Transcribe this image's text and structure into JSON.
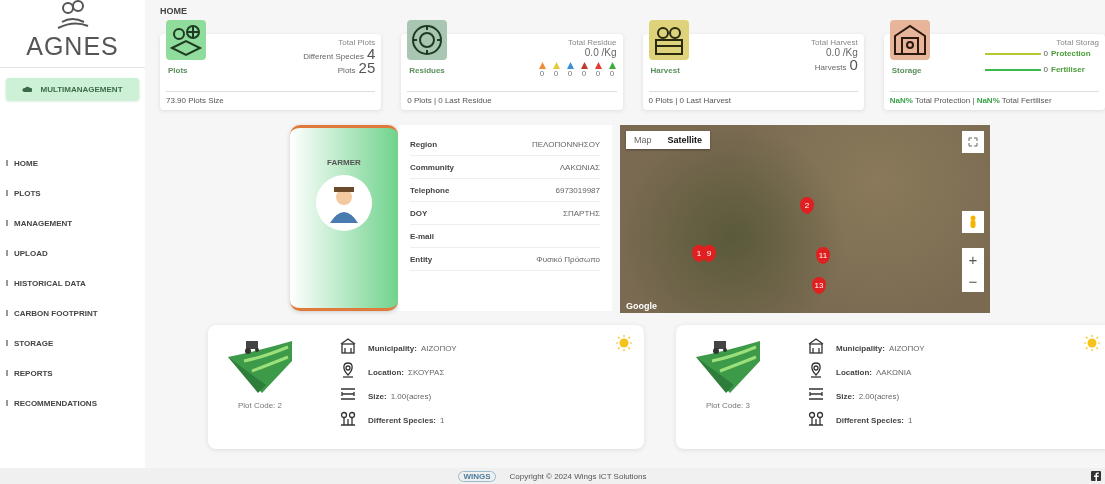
{
  "sidebar": {
    "logo": "AGNES",
    "button": "MULTIMANAGEMENT",
    "items": [
      {
        "label": "HOME"
      },
      {
        "label": "PLOTS"
      },
      {
        "label": "MANAGEMENT"
      },
      {
        "label": "UPLOAD"
      },
      {
        "label": "HISTORICAL DATA"
      },
      {
        "label": "CARBON FOOTPRINT"
      },
      {
        "label": "STORAGE"
      },
      {
        "label": "REPORTS"
      },
      {
        "label": "RECOMMENDATIONS"
      }
    ]
  },
  "page_title": "HOME",
  "cards": [
    {
      "kind": "plots",
      "title": "Plots",
      "header": "Total Plots",
      "stats": [
        {
          "label": "Different Species",
          "value": "4"
        },
        {
          "label": "Plots",
          "value": "25"
        }
      ],
      "footer": "73.90 Plots Size"
    },
    {
      "kind": "residues",
      "title": "Residues",
      "header": "Total Residue",
      "total": "0.0 /Kg",
      "residues": [
        {
          "value": "0",
          "color": "#f08a3c"
        },
        {
          "value": "0",
          "color": "#e8c93a"
        },
        {
          "value": "0",
          "color": "#3a8fd6"
        },
        {
          "value": "0",
          "color": "#c0392b"
        },
        {
          "value": "0",
          "color": "#e53935"
        },
        {
          "value": "0",
          "color": "#3cae3c"
        }
      ],
      "footer": "0 Plots | 0 Last Residue"
    },
    {
      "kind": "harvest",
      "title": "Harvest",
      "header": "Total Harvest",
      "total": "0.0 /Kg",
      "stats": [
        {
          "label": "Harvests",
          "value": "0"
        }
      ],
      "footer": "0 Plots | 0 Last Harvest"
    },
    {
      "kind": "storage",
      "title": "Storage",
      "header": "Total Storag",
      "bars": [
        {
          "value": "0",
          "label": "Protection",
          "level": 1,
          "color": "#b5c834"
        },
        {
          "value": "0",
          "label": "Fertiliser",
          "level": 1,
          "color": "#3cb94a"
        }
      ],
      "footer": "**NaN%** Total Protection | **NaN%** Total Fertiliser"
    }
  ],
  "farmer": {
    "title": "FARMER",
    "fields": [
      {
        "label": "Region",
        "value": "ΠΕΛΟΠΟΝΝΗΣΟΥ"
      },
      {
        "label": "Community",
        "value": "ΛΑΚΩΝΙΑΣ"
      },
      {
        "label": "Telephone",
        "value": "6973019987"
      },
      {
        "label": "DOY",
        "value": "ΣΠΑΡΤΗΣ"
      },
      {
        "label": "E-mail"
      },
      {
        "label": "Entity",
        "value": "Φυσικό Πρόσωπο"
      }
    ]
  },
  "map": {
    "tabs": [
      {
        "label": "Map",
        "selected": false
      },
      {
        "label": "Satellite",
        "selected": true
      }
    ],
    "markers": [
      "2",
      "1",
      "9",
      "11",
      "13"
    ],
    "zoom_in": "+",
    "zoom_out": "−",
    "brand": "Google"
  },
  "plots": [
    {
      "code": "Plot Code: 2",
      "fields": [
        {
          "kind": "municipality",
          "label": "Municipality:",
          "value": "ΑΙΖΟΠΟΥ"
        },
        {
          "kind": "location",
          "label": "Location:",
          "value": "ΣΚΟΥΡΑΣ"
        },
        {
          "kind": "size",
          "label": "Size:",
          "value": "1.00(acres)"
        },
        {
          "kind": "species",
          "label": "Different Species:",
          "value": "1"
        }
      ]
    },
    {
      "code": "Plot Code: 3",
      "fields": [
        {
          "kind": "municipality",
          "label": "Municipality:",
          "value": "ΑΙΖΟΠΟΥ"
        },
        {
          "kind": "location",
          "label": "Location:",
          "value": "ΛΑΚΩΝΙΑ"
        },
        {
          "kind": "size",
          "label": "Size:",
          "value": "2.00(acres)"
        },
        {
          "kind": "species",
          "label": "Different Species:",
          "value": "1"
        }
      ]
    }
  ],
  "footer": {
    "logo": "WINGS",
    "copyright": "Copyright © 2024 Wings ICT Solutions"
  }
}
